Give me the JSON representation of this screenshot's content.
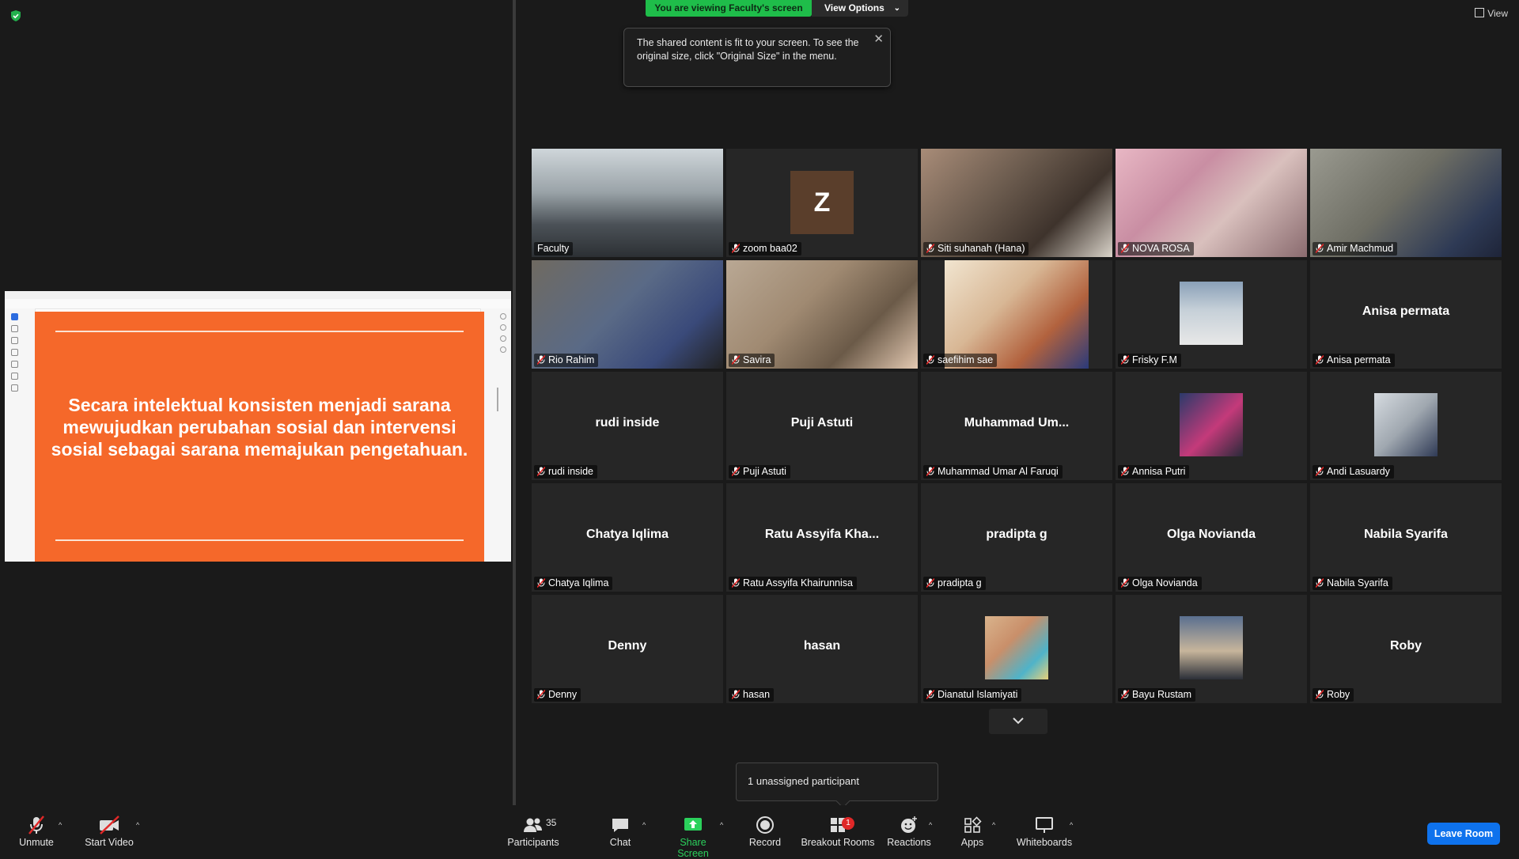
{
  "colors": {
    "accent_green": "#1fbd4a",
    "leave_blue": "#0e72ed",
    "active_outline": "#e2e24a",
    "slide_orange": "#f5682a"
  },
  "banner": {
    "viewing": "You are viewing Faculty's screen",
    "view_options": "View Options"
  },
  "tooltip": {
    "text": "The shared content is fit to your screen. To see the original size, click \"Original Size\" in the menu."
  },
  "view_top": {
    "label": "View"
  },
  "shared_slide": {
    "text": "Secara intelektual konsisten menjadi sarana mewujudkan perubahan sosial dan intervensi sosial sebagai sarana memajukan pengetahuan."
  },
  "participants": [
    {
      "name": "Faculty",
      "display": "",
      "type": "video",
      "active": true
    },
    {
      "name": "zoom baa02",
      "display": "Z",
      "type": "initial"
    },
    {
      "name": "Siti suhanah (Hana)",
      "display": "",
      "type": "video"
    },
    {
      "name": "NOVA ROSA",
      "display": "",
      "type": "video"
    },
    {
      "name": "Amir Machmud",
      "display": "",
      "type": "video"
    },
    {
      "name": "Rio Rahim",
      "display": "",
      "type": "video"
    },
    {
      "name": "Savira",
      "display": "",
      "type": "video"
    },
    {
      "name": "saefihim sae",
      "display": "",
      "type": "video"
    },
    {
      "name": "Frisky F.M",
      "display": "",
      "type": "photo"
    },
    {
      "name": "Anisa permata",
      "display": "Anisa permata",
      "type": "text"
    },
    {
      "name": "rudi inside",
      "display": "rudi inside",
      "type": "text"
    },
    {
      "name": "Puji Astuti",
      "display": "Puji Astuti",
      "type": "text"
    },
    {
      "name": "Muhammad Umar Al Faruqi",
      "display": "Muhammad  Um...",
      "type": "text"
    },
    {
      "name": "Annisa Putri",
      "display": "",
      "type": "photo"
    },
    {
      "name": "Andi Lasuardy",
      "display": "",
      "type": "photo"
    },
    {
      "name": "Chatya Iqlima",
      "display": "Chatya Iqlima",
      "type": "text"
    },
    {
      "name": "Ratu Assyifa Khairunnisa",
      "display": "Ratu Assyifa  Kha...",
      "type": "text"
    },
    {
      "name": "pradipta g",
      "display": "pradipta g",
      "type": "text"
    },
    {
      "name": "Olga Novianda",
      "display": "Olga Novianda",
      "type": "text"
    },
    {
      "name": "Nabila Syarifa",
      "display": "Nabila Syarifa",
      "type": "text"
    },
    {
      "name": "Denny",
      "display": "Denny",
      "type": "text"
    },
    {
      "name": "hasan",
      "display": "hasan",
      "type": "text"
    },
    {
      "name": "Dianatul Islamiyati",
      "display": "",
      "type": "photo"
    },
    {
      "name": "Bayu Rustam",
      "display": "",
      "type": "photo"
    },
    {
      "name": "Roby",
      "display": "Roby",
      "type": "text"
    }
  ],
  "unassigned": "1 unassigned participant",
  "toolbar": {
    "unmute": "Unmute",
    "start_video": "Start Video",
    "participants": "Participants",
    "participants_count": "35",
    "chat": "Chat",
    "share_screen": "Share Screen",
    "record": "Record",
    "breakout_rooms": "Breakout Rooms",
    "breakout_badge": "1",
    "reactions": "Reactions",
    "apps": "Apps",
    "whiteboards": "Whiteboards",
    "leave_room": "Leave Room"
  }
}
